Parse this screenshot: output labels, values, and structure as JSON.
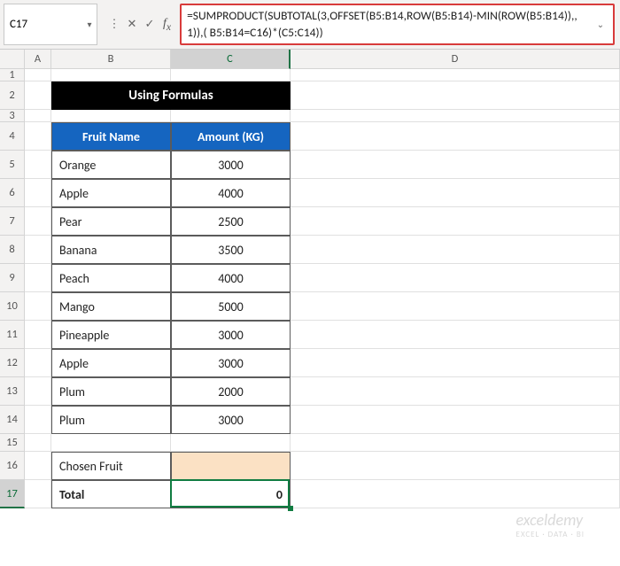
{
  "name_box": "C17",
  "formula": "=SUMPRODUCT(SUBTOTAL(3,OFFSET(B5:B14,ROW(B5:B14)-MIN(ROW(B5:B14)),,1)),( B5:B14=C16)*(C5:C14))",
  "columns": [
    "A",
    "B",
    "C",
    "D"
  ],
  "row_labels": [
    "1",
    "2",
    "3",
    "4",
    "5",
    "6",
    "7",
    "8",
    "9",
    "10",
    "11",
    "12",
    "13",
    "14",
    "15",
    "16",
    "17"
  ],
  "title": "Using Formulas",
  "headers": {
    "fruit": "Fruit Name",
    "amount": "Amount (KG)"
  },
  "rows": [
    {
      "fruit": "Orange",
      "amount": "3000"
    },
    {
      "fruit": "Apple",
      "amount": "4000"
    },
    {
      "fruit": "Pear",
      "amount": "2500"
    },
    {
      "fruit": "Banana",
      "amount": "3500"
    },
    {
      "fruit": "Peach",
      "amount": "4000"
    },
    {
      "fruit": "Mango",
      "amount": "5000"
    },
    {
      "fruit": "Pineapple",
      "amount": "3000"
    },
    {
      "fruit": "Apple",
      "amount": "3000"
    },
    {
      "fruit": "Plum",
      "amount": "2000"
    },
    {
      "fruit": "Plum",
      "amount": "3000"
    }
  ],
  "chosen_label": "Chosen Fruit",
  "chosen_value": "",
  "total_label": "Total",
  "total_value": "0",
  "watermark": {
    "main": "exceldemy",
    "sub": "EXCEL · DATA · BI"
  },
  "icons": {
    "dropdown": "▾",
    "cancel": "✕",
    "enter": "✓",
    "expand": "⌄",
    "sep": "⋮"
  }
}
